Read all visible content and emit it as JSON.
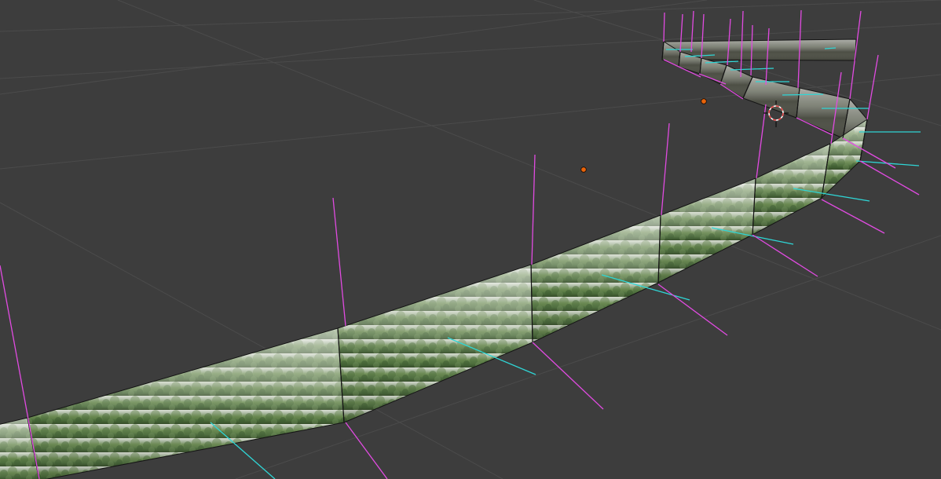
{
  "viewport": {
    "type": "3d-view",
    "background_color": "#3d3d3d",
    "grid_line_color": "#4b4b4b",
    "grid_visible": true
  },
  "curve_object": {
    "name": "",
    "texture": "forest-treeline",
    "texture_colors": [
      "#334a26",
      "#4a6b3a",
      "#6f8f55",
      "#a9b8a0",
      "#d8ddd2"
    ],
    "edge_color": "#141414",
    "cap_color": "#1c1c1c",
    "segment_count": 16,
    "closed": false
  },
  "overlays": {
    "normals": {
      "visible": true,
      "color": "#e14be1"
    },
    "tangents": {
      "visible": true,
      "color": "#2fd6d6"
    },
    "control_points": {
      "visible": true,
      "color": "#e8640a",
      "count": 2
    }
  },
  "cursor_3d": {
    "visible": true,
    "ring_color_a": "#e64545",
    "ring_color_b": "#ffffff"
  }
}
